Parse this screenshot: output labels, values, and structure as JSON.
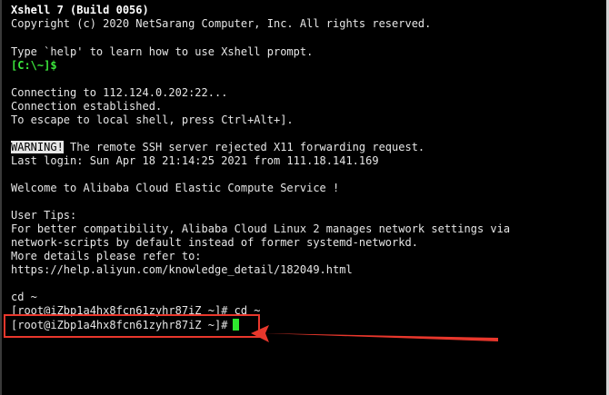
{
  "terminal": {
    "lines": {
      "l01": "Xshell 7 (Build 0056)",
      "l02": "Copyright (c) 2020 NetSarang Computer, Inc. All rights reserved.",
      "l03": "Type `help' to learn how to use Xshell prompt.",
      "l04": "[C:\\~]$",
      "l05": "Connecting to 112.124.0.202:22...",
      "l06": "Connection established.",
      "l07": "To escape to local shell, press Ctrl+Alt+].",
      "l08_tag": "WARNING!",
      "l08_rest": " The remote SSH server rejected X11 forwarding request.",
      "l09": "Last login: Sun Apr 18 21:14:25 2021 from 111.18.141.169",
      "l10": "Welcome to Alibaba Cloud Elastic Compute Service !",
      "l11": "User Tips:",
      "l12": "For better compatibility, Alibaba Cloud Linux 2 manages network settings via",
      "l13": "network-scripts by default instead of former systemd-networkd.",
      "l14": "More details please refer to:",
      "l15": "https://help.aliyun.com/knowledge_detail/182049.html",
      "l16": "cd ~",
      "l17": "[root@iZbp1a4hx8fcn61zyhr87iZ ~]# cd ~",
      "l18": "[root@iZbp1a4hx8fcn61zyhr87iZ ~]#"
    },
    "colors": {
      "background": "#000000",
      "text": "#e6e6e6",
      "prompt_green": "#3ce63c",
      "cursor": "#2ee62e",
      "annotation_red": "#e8372c"
    }
  }
}
